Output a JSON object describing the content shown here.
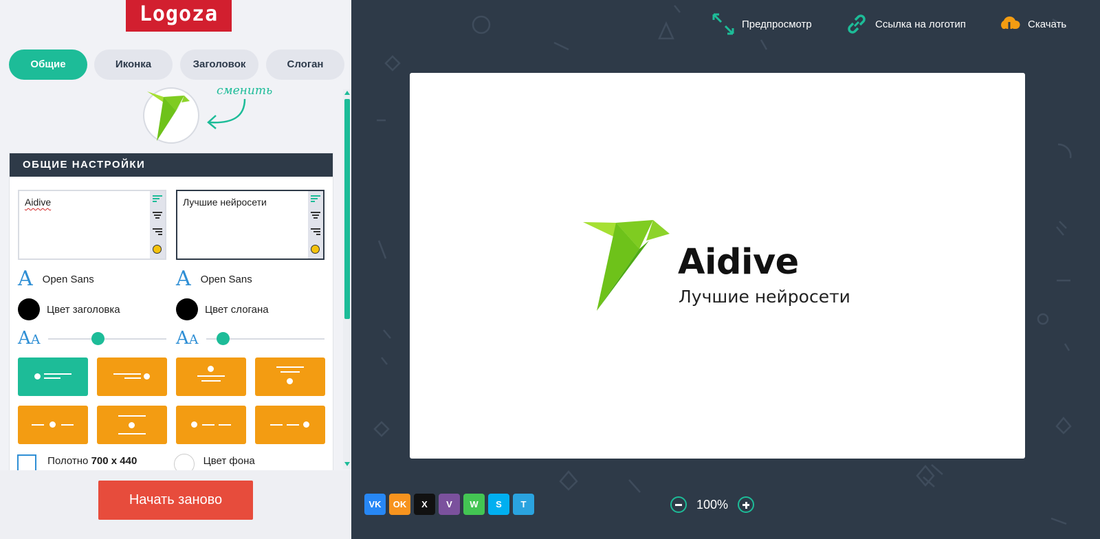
{
  "brand": {
    "name": "Logoza"
  },
  "tabs": [
    {
      "label": "Общие",
      "active": true
    },
    {
      "label": "Иконка",
      "active": false
    },
    {
      "label": "Заголовок",
      "active": false
    },
    {
      "label": "Слоган",
      "active": false
    }
  ],
  "icon_change_label": "сменить",
  "settings": {
    "title": "ОБЩИЕ НАСТРОЙКИ",
    "title_text": "Aidive",
    "slogan_text": "Лучшие нейросети",
    "title_font": "Open Sans",
    "slogan_font": "Open Sans",
    "title_color_label": "Цвет заголовка",
    "slogan_color_label": "Цвет слогана",
    "title_color": "#000000",
    "slogan_color": "#000000",
    "title_size_fraction": 0.42,
    "slogan_size_fraction": 0.14,
    "canvas_label": "Полотно",
    "canvas_size": "700 x 440",
    "bg_color_label": "Цвет фона"
  },
  "restart_label": "Начать заново",
  "toolbar": {
    "preview": "Предпросмотр",
    "link": "Ссылка на логотип",
    "download": "Скачать"
  },
  "preview": {
    "title": "Aidive",
    "slogan": "Лучшие нейросети"
  },
  "share": [
    {
      "icon": "vk-icon",
      "label": "VK",
      "color": "#2787f5"
    },
    {
      "icon": "odnoklassniki-icon",
      "label": "OK",
      "color": "#f7931e"
    },
    {
      "icon": "x-icon",
      "label": "X",
      "color": "#111111"
    },
    {
      "icon": "viber-icon",
      "label": "V",
      "color": "#7b519d"
    },
    {
      "icon": "whatsapp-icon",
      "label": "W",
      "color": "#43c553"
    },
    {
      "icon": "skype-icon",
      "label": "S",
      "color": "#00aff0"
    },
    {
      "icon": "telegram-icon",
      "label": "T",
      "color": "#2aa3df"
    }
  ],
  "zoom": {
    "level": "100%"
  },
  "colors": {
    "accent": "#1dbc98",
    "orange": "#f39c12",
    "red": "#e74c3c",
    "dark": "#2e3a48"
  }
}
